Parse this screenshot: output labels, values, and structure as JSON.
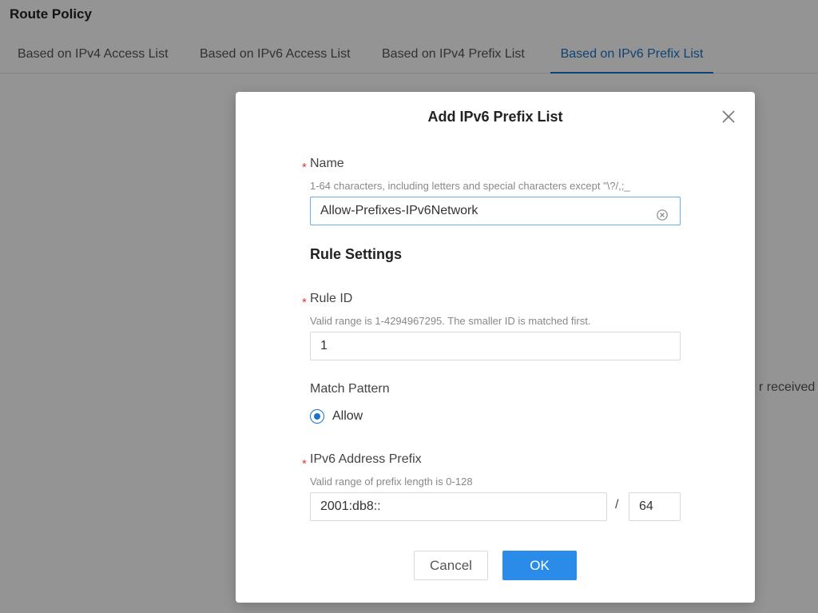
{
  "page": {
    "title": "Route Policy",
    "tabs": [
      {
        "label": "Based on IPv4 Access List"
      },
      {
        "label": "Based on IPv6 Access List"
      },
      {
        "label": "Based on IPv4 Prefix List"
      },
      {
        "label": "Based on IPv6 Prefix List",
        "active": true
      }
    ],
    "background_text": "r received"
  },
  "modal": {
    "title": "Add IPv6 Prefix List",
    "required_mark": "*",
    "name": {
      "label": "Name",
      "hint": "1-64 characters, including letters and special characters except \"\\?/,;_",
      "value": "Allow-Prefixes-IPv6Network"
    },
    "rule_settings": {
      "title": "Rule Settings",
      "rule_id": {
        "label": "Rule ID",
        "hint": "Valid range is 1-4294967295. The smaller ID is matched first.",
        "value": "1"
      },
      "match_pattern": {
        "label": "Match Pattern",
        "option": "Allow",
        "selected": true
      },
      "prefix": {
        "label": "IPv6 Address Prefix",
        "hint": "Valid range of prefix length is 0-128",
        "address": "2001:db8::",
        "separator": "/",
        "length": "64"
      }
    },
    "buttons": {
      "cancel": "Cancel",
      "ok": "OK"
    }
  },
  "colors": {
    "accent": "#1a73c9",
    "ok_button": "#2a8ce8",
    "required": "#e0383e"
  }
}
